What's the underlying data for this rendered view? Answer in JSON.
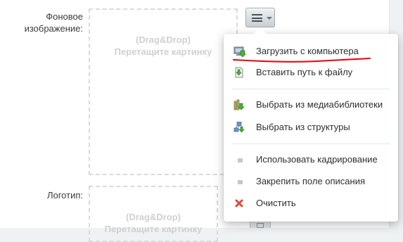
{
  "form": {
    "background_label": "Фоновое\nизображение:",
    "logo_label": "Логотип:",
    "dropzone": {
      "line1": "(Drag&Drop)",
      "line2": "Перетащите картинку"
    }
  },
  "menu": {
    "items": [
      {
        "label": "Загрузить с компьютера",
        "icon": "computer-upload-icon"
      },
      {
        "label": "Вставить путь к файлу",
        "icon": "file-path-icon"
      },
      {
        "label": "Выбрать из медиабиблиотеки",
        "icon": "media-library-icon"
      },
      {
        "label": "Выбрать из структуры",
        "icon": "structure-icon"
      },
      {
        "label": "Использовать кадрирование",
        "icon": "bullet-icon"
      },
      {
        "label": "Закрепить поле описания",
        "icon": "bullet-icon"
      },
      {
        "label": "Очистить",
        "icon": "clear-x-icon"
      }
    ]
  },
  "colors": {
    "highlight_underline": "#e8000b",
    "clear_icon": "#e2463b",
    "dropzone_text": "#cdd1d4"
  }
}
